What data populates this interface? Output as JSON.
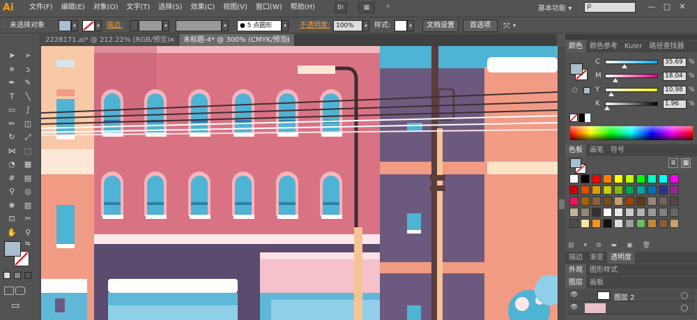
{
  "app": {
    "logo": "Ai"
  },
  "menu": [
    "文件(F)",
    "编辑(E)",
    "对象(O)",
    "文字(T)",
    "选择(S)",
    "效果(C)",
    "视图(V)",
    "窗口(W)",
    "帮助(H)"
  ],
  "menubar_icons": [
    "Br",
    "▦",
    "✧"
  ],
  "workspace": "基本功能",
  "workspace_arrow": "▾",
  "search_icon": "ρ",
  "window_buttons": [
    "—",
    "□",
    "✕"
  ],
  "control": {
    "selection_label": "未选择对象",
    "stroke_label": "描边:",
    "brush_label": "● 5 点圆形",
    "opacity_label": "不透明度:",
    "opacity_value": "100%",
    "style_label": "样式:",
    "doc_settings": "文档设置",
    "preferences": "首选项",
    "arrow": "▾",
    "extra_icon": "⤧"
  },
  "tabs": [
    {
      "label": "2228171.ai* @ 212.22% (RGB/预览)",
      "close": "×"
    },
    {
      "label": "未标题-4* @ 300% (CMYK/预览)",
      "close": "×"
    }
  ],
  "tools": [
    {
      "name": "selection-tool",
      "glyph": "➤"
    },
    {
      "name": "direct-selection-tool",
      "glyph": "➢"
    },
    {
      "name": "magic-wand-tool",
      "glyph": "✳"
    },
    {
      "name": "lasso-tool",
      "glyph": "ↄ"
    },
    {
      "name": "pen-tool",
      "glyph": "✒"
    },
    {
      "name": "curvature-tool",
      "glyph": "✎"
    },
    {
      "name": "type-tool",
      "glyph": "T"
    },
    {
      "name": "line-tool",
      "glyph": "╲"
    },
    {
      "name": "rectangle-tool",
      "glyph": "▭"
    },
    {
      "name": "paintbrush-tool",
      "glyph": "∫"
    },
    {
      "name": "pencil-tool",
      "glyph": "✏"
    },
    {
      "name": "eraser-tool",
      "glyph": "◫"
    },
    {
      "name": "rotate-tool",
      "glyph": "↻"
    },
    {
      "name": "scale-tool",
      "glyph": "⤢"
    },
    {
      "name": "width-tool",
      "glyph": "⋈"
    },
    {
      "name": "free-transform-tool",
      "glyph": "⬚"
    },
    {
      "name": "shape-builder-tool",
      "glyph": "◔"
    },
    {
      "name": "perspective-grid-tool",
      "glyph": "▦"
    },
    {
      "name": "mesh-tool",
      "glyph": "#"
    },
    {
      "name": "gradient-tool",
      "glyph": "▤"
    },
    {
      "name": "eyedropper-tool",
      "glyph": "⚲"
    },
    {
      "name": "blend-tool",
      "glyph": "◎"
    },
    {
      "name": "symbol-sprayer-tool",
      "glyph": "❀"
    },
    {
      "name": "column-graph-tool",
      "glyph": "▥"
    },
    {
      "name": "artboard-tool",
      "glyph": "⊡"
    },
    {
      "name": "slice-tool",
      "glyph": "✂"
    },
    {
      "name": "hand-tool",
      "glyph": "✋"
    },
    {
      "name": "zoom-tool",
      "glyph": "⚲"
    }
  ],
  "toolbar_extra": {
    "swap_icon": "⇆",
    "screen_mode_icon": "▭"
  },
  "color_panel": {
    "tabs": [
      "颜色",
      "颜色参考",
      "Kuler",
      "路径查找器"
    ],
    "menu_icon": "≡",
    "channels": [
      {
        "label": "C",
        "value": "35.69",
        "unit": "%",
        "fill": 0.3569,
        "grad": "linear-gradient(90deg,#fff,#00aeef)"
      },
      {
        "label": "M",
        "value": "18.04",
        "unit": "%",
        "fill": 0.1804,
        "grad": "linear-gradient(90deg,#fff,#ec008c)"
      },
      {
        "label": "Y",
        "value": "10.98",
        "unit": "%",
        "fill": 0.1098,
        "grad": "linear-gradient(90deg,#fff,#fff200)"
      },
      {
        "label": "K",
        "value": "1.96",
        "unit": "%",
        "fill": 0.0196,
        "grad": "linear-gradient(90deg,#fff,#000)"
      }
    ]
  },
  "swatch_panel": {
    "tabs": [
      "色板",
      "画笔",
      "符号"
    ],
    "colors": [
      "#ffffff",
      "#000000",
      "#ff0000",
      "#ff7f00",
      "#ffff00",
      "#bfff00",
      "#00ff00",
      "#00ffbf",
      "#00ffff",
      "#ff00ff",
      "#cc0000",
      "#dc4e00",
      "#e59c00",
      "#c9cc00",
      "#7fbf00",
      "#00a651",
      "#00a99d",
      "#0072bc",
      "#2e3192",
      "#92278f",
      "#ed145b",
      "#a3620a",
      "#8c6239",
      "#754c24",
      "#c69c6d",
      "#a0410d",
      "#603913",
      "#998675",
      "#736357",
      "#534741",
      "#c7b299",
      "#998675",
      "#362f2d",
      "#ffffff",
      "#e6e6e6",
      "#cccccc",
      "#b3b3b3",
      "#999999",
      "#808080",
      "#666666"
    ],
    "patterns": [
      "#4d4d4d",
      "#f3e4a8",
      "#f7941d",
      "#111111",
      "#dddddd",
      "#9e9e9e",
      "#6bbf5a",
      "#c2873d",
      "#8a5b3a",
      "#c8a06e"
    ]
  },
  "bottom_panels": {
    "tabs1": [
      "描边",
      "渐变",
      "透明度"
    ],
    "tabs2": [
      "外观",
      "图形样式"
    ],
    "tabs3": [
      "图层",
      "画板"
    ],
    "layer_name": "图层 2",
    "eye_icon": "👁"
  },
  "colors": {
    "wall_pink": "#d97384",
    "wall_salmon": "#f29b84",
    "purple": "#6c5a7e",
    "window_blue": "#4fb3d4",
    "pole": "#5a3d3d"
  }
}
